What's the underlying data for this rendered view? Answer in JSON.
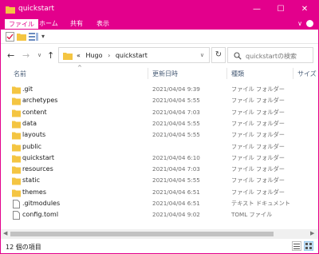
{
  "window": {
    "title": "quickstart",
    "minimize_glyph": "—",
    "maximize_glyph": "☐",
    "close_glyph": "✕"
  },
  "ribbon": {
    "tabs": [
      "ファイル",
      "ホーム",
      "共有",
      "表示"
    ],
    "active_tab": "ファイル",
    "collapse_glyph": "∨"
  },
  "qat": {
    "dropdown_glyph": "▾"
  },
  "nav": {
    "back_glyph": "←",
    "forward_glyph": "→",
    "recent_glyph": "∨",
    "up_glyph": "↑"
  },
  "address": {
    "crumbs": [
      "«",
      "Hugo",
      "›",
      "quickstart"
    ],
    "dropdown_glyph": "∨",
    "refresh_glyph": "↻"
  },
  "search": {
    "placeholder": "quickstartの検索"
  },
  "columns": {
    "name": "名前",
    "date": "更新日時",
    "type": "種類",
    "size": "サイズ"
  },
  "files": [
    {
      "name": ".git",
      "date": "2021/04/04 9:39",
      "type": "ファイル フォルダー",
      "kind": "folder"
    },
    {
      "name": "archetypes",
      "date": "2021/04/04 5:55",
      "type": "ファイル フォルダー",
      "kind": "folder"
    },
    {
      "name": "content",
      "date": "2021/04/04 7:03",
      "type": "ファイル フォルダー",
      "kind": "folder"
    },
    {
      "name": "data",
      "date": "2021/04/04 5:55",
      "type": "ファイル フォルダー",
      "kind": "folder"
    },
    {
      "name": "layouts",
      "date": "2021/04/04 5:55",
      "type": "ファイル フォルダー",
      "kind": "folder"
    },
    {
      "name": "public",
      "date": "",
      "type": "ファイル フォルダー",
      "kind": "folder"
    },
    {
      "name": "quickstart",
      "date": "2021/04/04 6:10",
      "type": "ファイル フォルダー",
      "kind": "folder"
    },
    {
      "name": "resources",
      "date": "2021/04/04 7:03",
      "type": "ファイル フォルダー",
      "kind": "folder"
    },
    {
      "name": "static",
      "date": "2021/04/04 5:55",
      "type": "ファイル フォルダー",
      "kind": "folder"
    },
    {
      "name": "themes",
      "date": "2021/04/04 6:51",
      "type": "ファイル フォルダー",
      "kind": "folder"
    },
    {
      "name": ".gitmodules",
      "date": "2021/04/04 6:51",
      "type": "テキスト ドキュメント",
      "kind": "file"
    },
    {
      "name": "config.toml",
      "date": "2021/04/04 9:02",
      "type": "TOML ファイル",
      "kind": "file"
    }
  ],
  "status": {
    "item_count": "12 個の項目"
  },
  "colors": {
    "accent": "#e3008c",
    "folder": "#f4c542",
    "header_text": "#4c607a"
  }
}
